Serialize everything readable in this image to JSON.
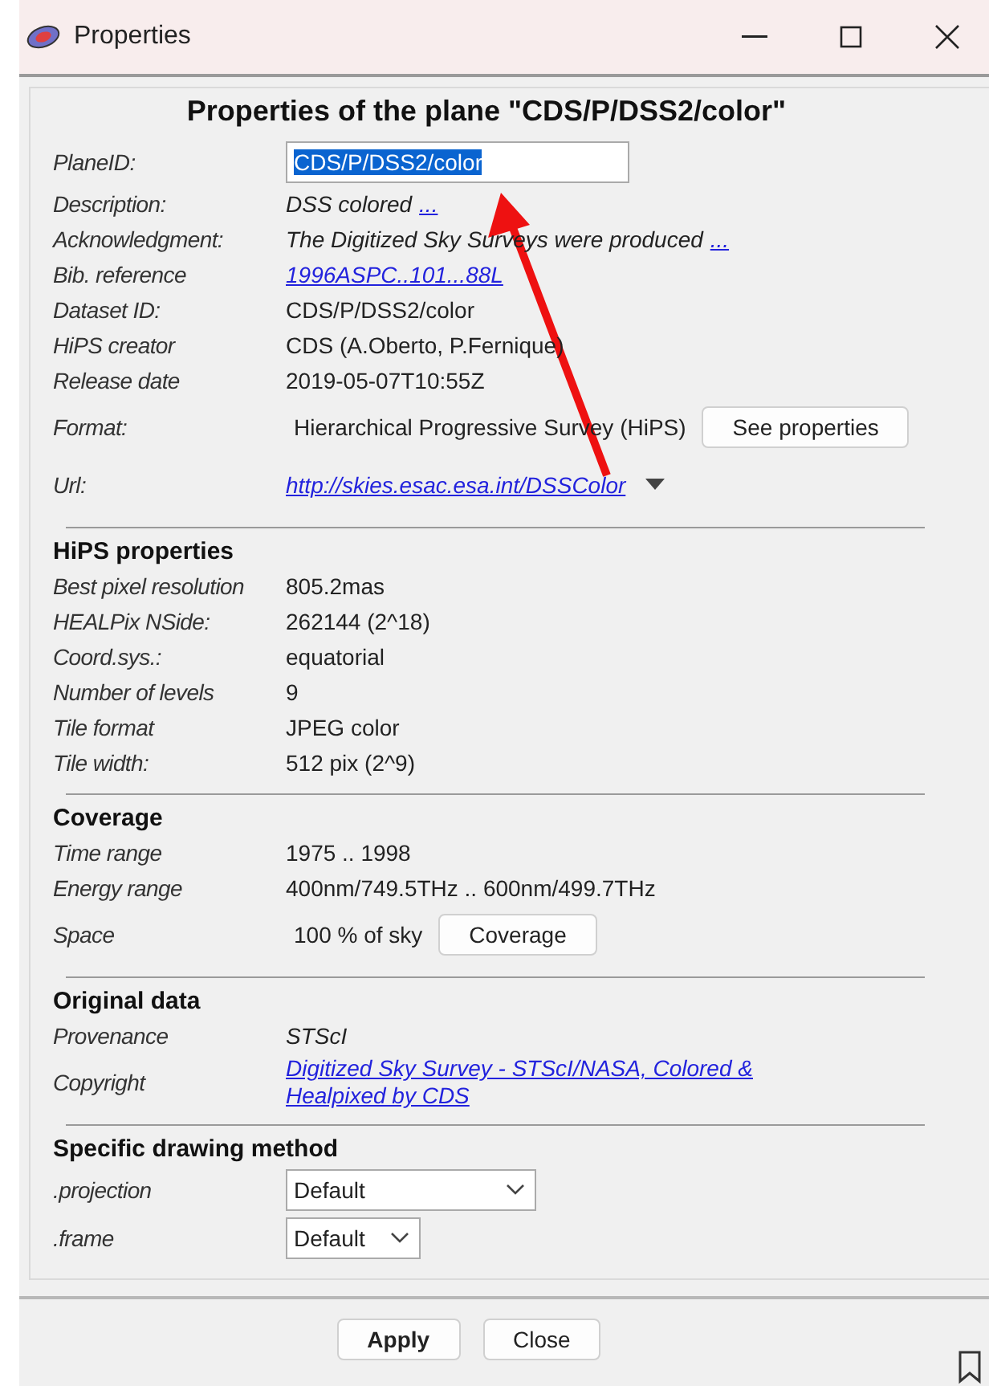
{
  "window": {
    "title": "Properties"
  },
  "heading": "Properties of the plane \"CDS/P/DSS2/color\"",
  "sections": [
    {
      "rows": [
        {
          "kind": "field",
          "label": "PlaneID:",
          "value": "CDS/P/DSS2/color",
          "selected": true
        },
        {
          "kind": "text",
          "label": "Description:",
          "value": "DSS colored",
          "italic": true,
          "link": "..."
        },
        {
          "kind": "text",
          "label": "Acknowledgment:",
          "value": "The Digitized Sky Surveys were produced",
          "italic": true,
          "link": "..."
        },
        {
          "kind": "link",
          "label": "Bib. reference",
          "value": "1996ASPC..101...88L"
        },
        {
          "kind": "text",
          "label": "Dataset ID:",
          "value": "CDS/P/DSS2/color"
        },
        {
          "kind": "text",
          "label": "HiPS creator",
          "value": "CDS (A.Oberto, P.Fernique)"
        },
        {
          "kind": "text",
          "label": "Release date",
          "value": "2019-05-07T10:55Z"
        },
        {
          "kind": "button",
          "label": "Format:",
          "value": "Hierarchical Progressive Survey (HiPS)",
          "button": "See properties"
        },
        {
          "kind": "menu_link",
          "label": "Url:",
          "value": "http://skies.esac.esa.int/DSSColor"
        }
      ]
    },
    {
      "title": "HiPS properties",
      "rows": [
        {
          "kind": "text",
          "label": "Best pixel resolution",
          "value": "805.2mas"
        },
        {
          "kind": "text",
          "label": "HEALPix NSide:",
          "value": "262144 (2^18)"
        },
        {
          "kind": "text",
          "label": "Coord.sys.:",
          "value": "equatorial"
        },
        {
          "kind": "text",
          "label": "Number of levels",
          "value": "9"
        },
        {
          "kind": "text",
          "label": "Tile format",
          "value": "JPEG color"
        },
        {
          "kind": "text",
          "label": "Tile width:",
          "value": "512 pix (2^9)"
        }
      ]
    },
    {
      "title": "Coverage",
      "rows": [
        {
          "kind": "text",
          "label": "Time range",
          "value": "1975 .. 1998"
        },
        {
          "kind": "text",
          "label": "Energy range",
          "value": "400nm/749.5THz .. 600nm/499.7THz"
        },
        {
          "kind": "button",
          "label": "Space",
          "value": "100 % of sky",
          "button": "Coverage"
        }
      ]
    },
    {
      "title": "Original data",
      "rows": [
        {
          "kind": "text",
          "label": "Provenance",
          "value": "STScI",
          "italic": true
        },
        {
          "kind": "link",
          "label": "Copyright",
          "value": "Digitized Sky Survey - STScI/NASA, Colored & Healpixed by CDS"
        }
      ]
    },
    {
      "title": "Specific drawing method",
      "rows": [
        {
          "kind": "select",
          "label": ".projection",
          "value": "Default",
          "wide": true
        },
        {
          "kind": "select",
          "label": ".frame",
          "value": "Default",
          "wide": false
        }
      ]
    }
  ],
  "buttons": [
    {
      "label": "Apply",
      "default": true
    },
    {
      "label": "Close",
      "default": false
    }
  ]
}
